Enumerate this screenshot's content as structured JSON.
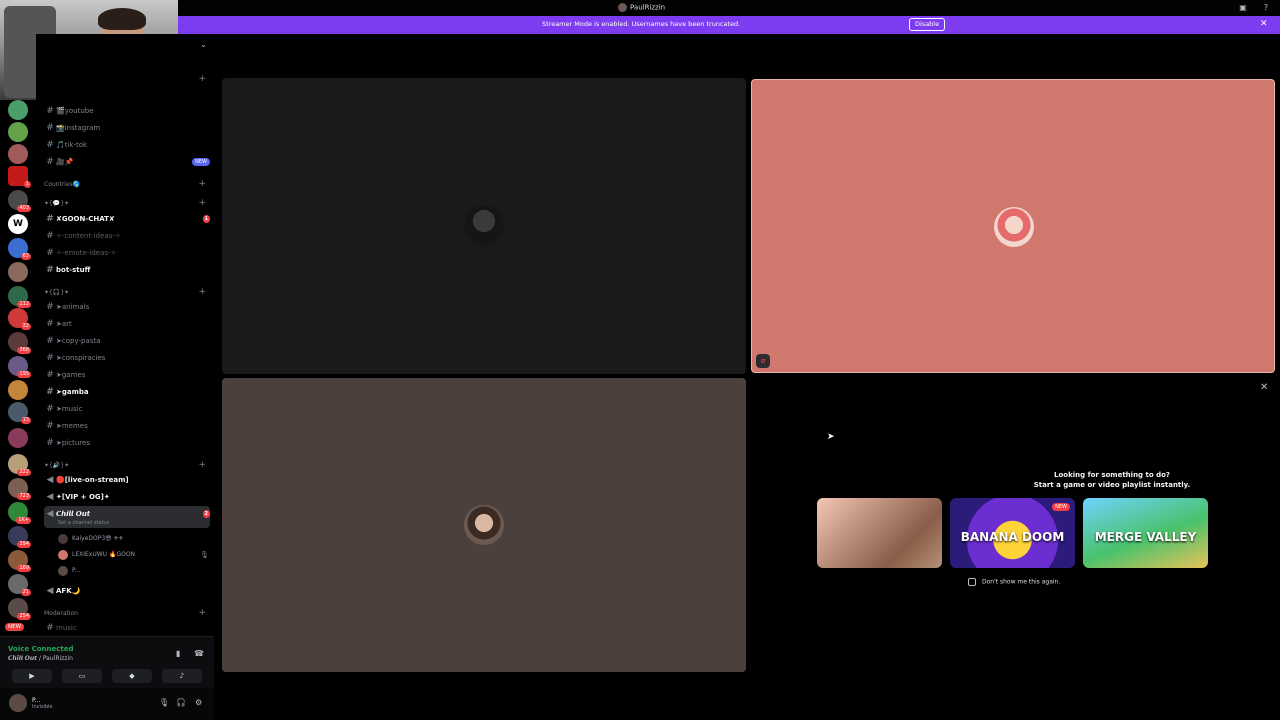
{
  "window": {
    "title": "PaulRizzin"
  },
  "banner": {
    "text": "Streamer Mode is enabled. Usernames have been truncated.",
    "button_label": "Disable"
  },
  "server_rail": {
    "badges": [
      "1",
      "403",
      "63",
      "112",
      "32",
      "368",
      "195",
      "13",
      "222",
      "723",
      "1K+",
      "394",
      "169",
      "21",
      "254"
    ],
    "new_label": "NEW"
  },
  "channels": {
    "items": [
      {
        "label": "🎬youtube"
      },
      {
        "label": "📸instagram"
      },
      {
        "label": "🎵tik-tok"
      },
      {
        "label": "🎥📌",
        "badge": "NEW"
      },
      {
        "label": "Countries🌎"
      },
      {
        "label": "✘GOON-CHAT✘",
        "badge": "1"
      },
      {
        "label": "✧-content-ideas-✧"
      },
      {
        "label": "✧-emote-ideas-✧"
      },
      {
        "label": "bot-stuff"
      },
      {
        "label": "➤animals"
      },
      {
        "label": "➤art"
      },
      {
        "label": "➤copy-pasta"
      },
      {
        "label": "➤conspiracies"
      },
      {
        "label": "➤games"
      },
      {
        "label": "➤gamba"
      },
      {
        "label": "➤music"
      },
      {
        "label": "➤memes"
      },
      {
        "label": "➤pictures"
      },
      {
        "label": "🔴[live-on-stream]"
      },
      {
        "label": "✦[VIP + OG]✦"
      },
      {
        "label": "𝘾𝙝𝙞𝙡𝙡 𝙊𝙪𝙩",
        "badge": "2",
        "status": "Set a channel status"
      },
      {
        "label": "AFK🌙"
      },
      {
        "label": "music"
      }
    ],
    "categories": [
      "✦{💬}✦",
      "✦{🎧}✦",
      "✦{🔊}✦",
      "Moderation"
    ],
    "voice_users": [
      {
        "name": "KaiyeDOP3😎 ✈✈"
      },
      {
        "name": "LEXIExUWU 🔥GOON"
      },
      {
        "name": "P..."
      }
    ]
  },
  "voice_panel": {
    "title": "Voice Connected",
    "subtitle": "𝘾𝙝𝙞𝙡𝙡 𝙊𝙪𝙩 / PaulRizzin"
  },
  "user_panel": {
    "name": "P...",
    "status": "Invisible"
  },
  "activity": {
    "line1": "Looking for something to do?",
    "line2": "Start a game or video playlist instantly.",
    "games": [
      {
        "label": "",
        "badge": ""
      },
      {
        "label": "BANANA DOOM",
        "badge": "NEW"
      },
      {
        "label": "MERGE VALLEY",
        "badge": ""
      }
    ],
    "dont_show": "Don't show me this again."
  },
  "colors": {
    "banner": "#7d3cf0",
    "voice_connected": "#23a55a",
    "badge_red": "#f23f43",
    "tile_pink": "#d0786e",
    "tile_brown": "#4c403d"
  }
}
